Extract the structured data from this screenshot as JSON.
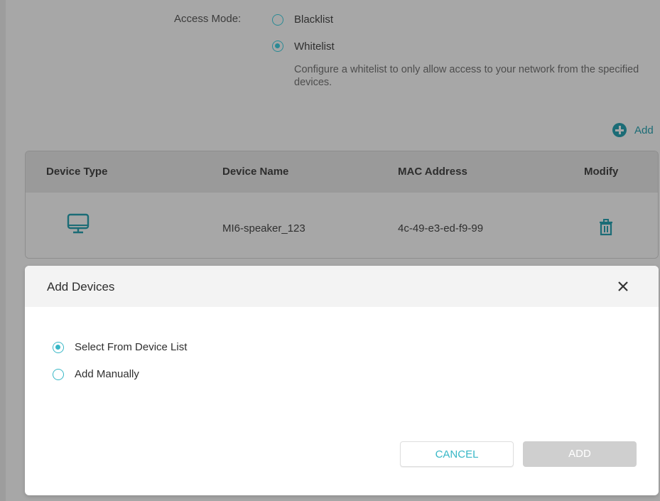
{
  "access": {
    "label": "Access Mode:",
    "options": [
      {
        "label": "Blacklist",
        "selected": false
      },
      {
        "label": "Whitelist",
        "selected": true
      }
    ],
    "description": "Configure a whitelist to only allow access to your network from the specified devices."
  },
  "add_link": "Add",
  "table": {
    "headers": [
      "Device Type",
      "Device Name",
      "MAC Address",
      "Modify"
    ],
    "rows": [
      {
        "device_type_icon": "monitor-icon",
        "name": "MI6-speaker_123",
        "mac": "4c-49-e3-ed-f9-99",
        "modify_icon": "trash-icon"
      }
    ]
  },
  "modal": {
    "title": "Add Devices",
    "options": [
      {
        "label": "Select From Device List",
        "selected": true
      },
      {
        "label": "Add Manually",
        "selected": false
      }
    ],
    "cancel_label": "CANCEL",
    "add_label": "ADD"
  },
  "colors": {
    "overlay_bg": "#a7a7a7",
    "accent": "#37b7c6",
    "accent_dimmed": "#1b6c76",
    "add_disabled": "#cfcfcf"
  }
}
